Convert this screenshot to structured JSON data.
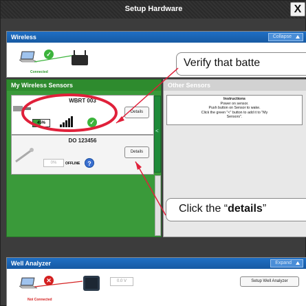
{
  "window": {
    "title": "Setup Hardware",
    "close_label": "X"
  },
  "wireless": {
    "header": "Wireless",
    "collapse_label": "Collapse",
    "status": "Connected",
    "status_color": "#2e9a2e"
  },
  "my_sensors": {
    "header": "My Wireless Sensors",
    "sensors": [
      {
        "name": "WBRT 003",
        "battery": "45%",
        "battery_level": 0.45,
        "details_label": "Details"
      },
      {
        "name": "DO 123456",
        "battery": "0%",
        "status": "OFFLINE",
        "details_label": "Details"
      }
    ],
    "add_arrow": "<"
  },
  "other_sensors": {
    "header": "Other Sensors",
    "instructions_title": "Instructions",
    "instructions_lines": [
      "Power on sensor.",
      "Push button on Sensor to wake.",
      "Click the green \"<\" button to add it to \"My",
      "Sensors\"."
    ]
  },
  "callouts": {
    "battery": "Verify that batte",
    "details_prefix": "Click the “",
    "details_bold": "details",
    "details_suffix": "”"
  },
  "well_analyzer": {
    "header": "Well Analyzer",
    "expand_label": "Expand",
    "status": "Not Connected",
    "status_color": "#d42020",
    "voltage": "0.0 V",
    "setup_button": "Setup Well Analyzer"
  },
  "colors": {
    "accent_blue": "#1f6fc4",
    "sensor_green": "#3a9a3a",
    "annotation_red": "#e0203a"
  }
}
